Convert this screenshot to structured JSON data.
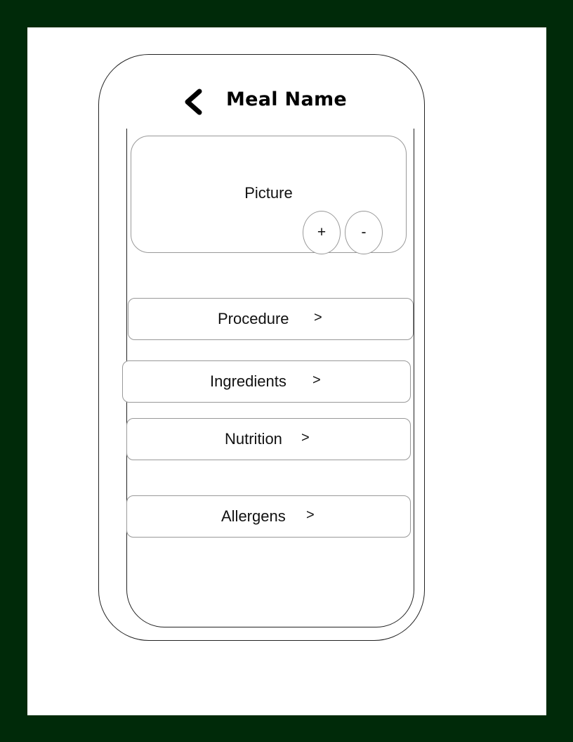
{
  "header": {
    "title": "Meal Name",
    "back_icon": "chevron-left-icon"
  },
  "picture": {
    "label": "Picture",
    "zoom_in_label": "+",
    "zoom_out_label": "-"
  },
  "menu": {
    "procedure": {
      "label": "Procedure",
      "chevron": ">"
    },
    "ingredients": {
      "label": "Ingredients",
      "chevron": ">"
    },
    "nutrition": {
      "label": "Nutrition",
      "chevron": ">"
    },
    "allergens": {
      "label": "Allergens",
      "chevron": ">"
    }
  },
  "colors": {
    "frame": "#002a09",
    "page": "#ffffff",
    "outline": "#222222",
    "soft_outline": "#999999"
  }
}
